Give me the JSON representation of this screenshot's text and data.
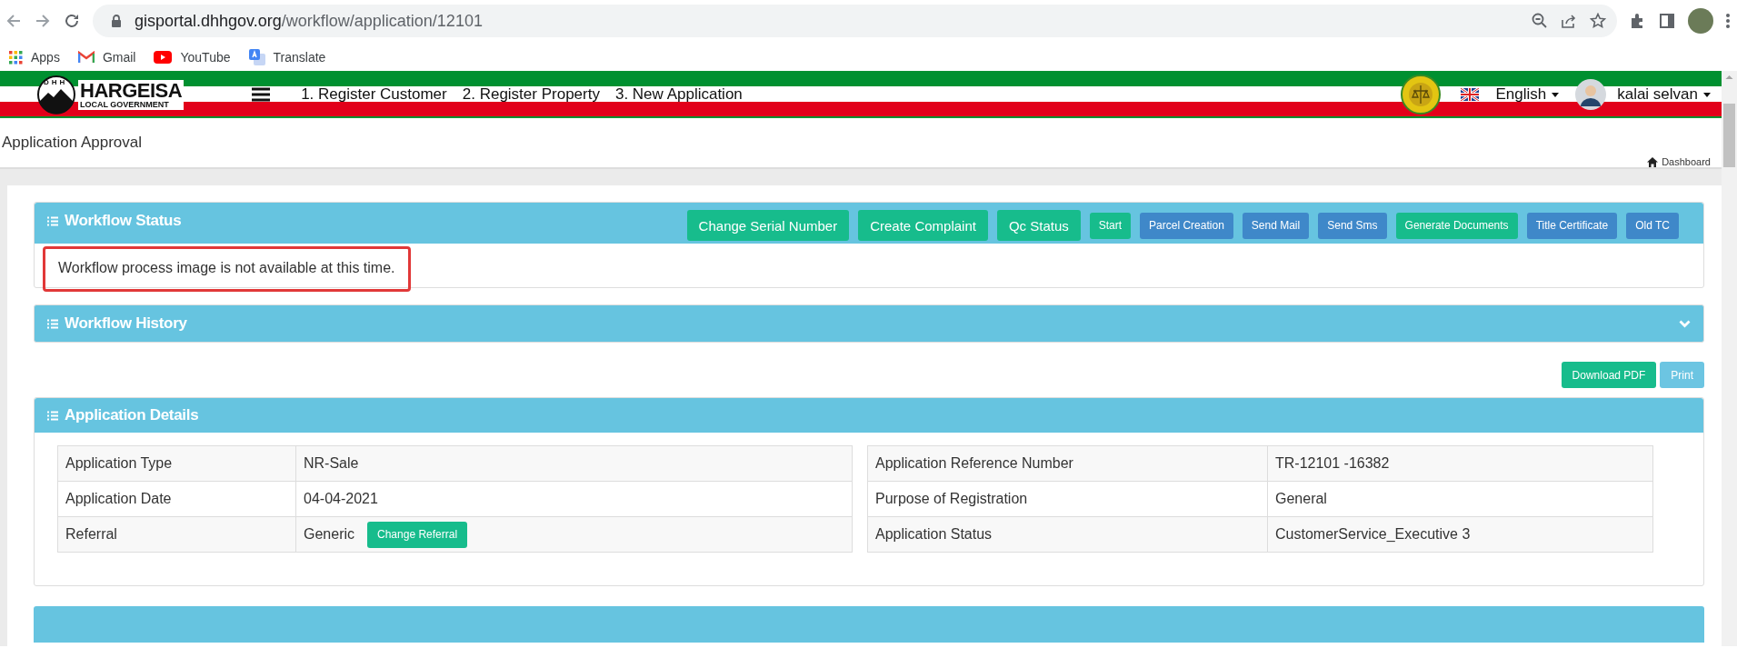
{
  "browser": {
    "url_host": "gisportal.dhhgov.org",
    "url_path": "/workflow/application/12101",
    "bookmarks": [
      {
        "label": "Apps",
        "kind": "apps"
      },
      {
        "label": "Gmail",
        "kind": "gmail"
      },
      {
        "label": "YouTube",
        "kind": "youtube"
      },
      {
        "label": "Translate",
        "kind": "translate"
      }
    ]
  },
  "header": {
    "logo_badge": "DHH",
    "logo_title": "HARGEISA",
    "logo_subtitle": "LOCAL GOVERNMENT",
    "nav": [
      "1. Register Customer",
      "2. Register Property",
      "3. New Application"
    ],
    "language": "English",
    "user": "kalai selvan"
  },
  "page": {
    "title": "Application Approval",
    "breadcrumb": "Dashboard"
  },
  "workflow_status": {
    "title": "Workflow Status",
    "buttons": [
      {
        "label": "Change Serial Number",
        "kind": "large",
        "color": "#17bc8c"
      },
      {
        "label": "Create Complaint",
        "kind": "large",
        "color": "#17bc8c"
      },
      {
        "label": "Qc Status",
        "kind": "large",
        "color": "#17bc8c"
      },
      {
        "label": "Start",
        "kind": "small",
        "color": "#17bc8c"
      },
      {
        "label": "Parcel Creation",
        "kind": "small",
        "color": "#3f88c9"
      },
      {
        "label": "Send Mail",
        "kind": "small",
        "color": "#3f88c9"
      },
      {
        "label": "Send Sms",
        "kind": "small",
        "color": "#3f88c9"
      },
      {
        "label": "Generate Documents",
        "kind": "small",
        "color": "#17bc8c"
      },
      {
        "label": "Title Certificate",
        "kind": "small",
        "color": "#3f88c9"
      },
      {
        "label": "Old TC",
        "kind": "small",
        "color": "#3f88c9"
      }
    ],
    "message": "Workflow process image is not available at this time.",
    "message_highlighted": true
  },
  "workflow_history": {
    "title": "Workflow History",
    "expanded": false
  },
  "actions": [
    {
      "label": "Download PDF",
      "color": "#17bc8c"
    },
    {
      "label": "Print",
      "color": "#6cc5e2"
    }
  ],
  "application_details": {
    "title": "Application Details",
    "left_rows": [
      {
        "label": "Application Type",
        "value": "NR-Sale"
      },
      {
        "label": "Application Date",
        "value": "04-04-2021"
      },
      {
        "label": "Referral",
        "value": "Generic",
        "button": "Change Referral"
      }
    ],
    "right_rows": [
      {
        "label": "Application Reference Number",
        "value": "TR-12101 -16382"
      },
      {
        "label": "Purpose of Registration",
        "value": "General"
      },
      {
        "label": "Application Status",
        "value": "CustomerService_Executive 3"
      }
    ]
  }
}
